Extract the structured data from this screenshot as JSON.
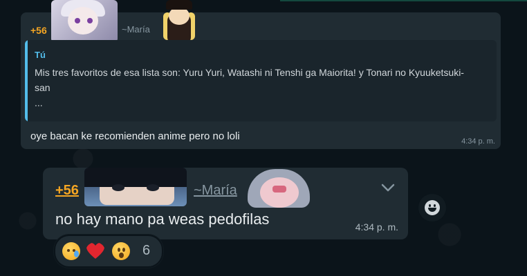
{
  "message1": {
    "sender_phone": "+56",
    "sender_name": "~María",
    "quote": {
      "author": "Tú",
      "text": "Mis tres favoritos de esa lista son: Yuru Yuri, Watashi ni Tenshi ga Maiorita! y Tonari no Kyuuketsuki-san",
      "ellipsis": "..."
    },
    "text": "oye bacan ke recomienden anime pero no loli",
    "time": "4:34 p. m."
  },
  "message2": {
    "sender_phone": "+56",
    "sender_name": "~María",
    "text": "no hay mano pa weas pedofilas",
    "time": "4:34 p. m.",
    "reactions": {
      "emojis": [
        "crying-face",
        "red-heart",
        "surprised-face"
      ],
      "count": "6"
    }
  },
  "colors": {
    "background": "#0b141a",
    "bubble": "#202c33",
    "sender": "#f5a623",
    "quote_accent": "#53bdeb",
    "meta": "#8696a0"
  },
  "icons": {
    "chevron": "chevron-down-icon",
    "react": "emoji-smile-icon"
  }
}
